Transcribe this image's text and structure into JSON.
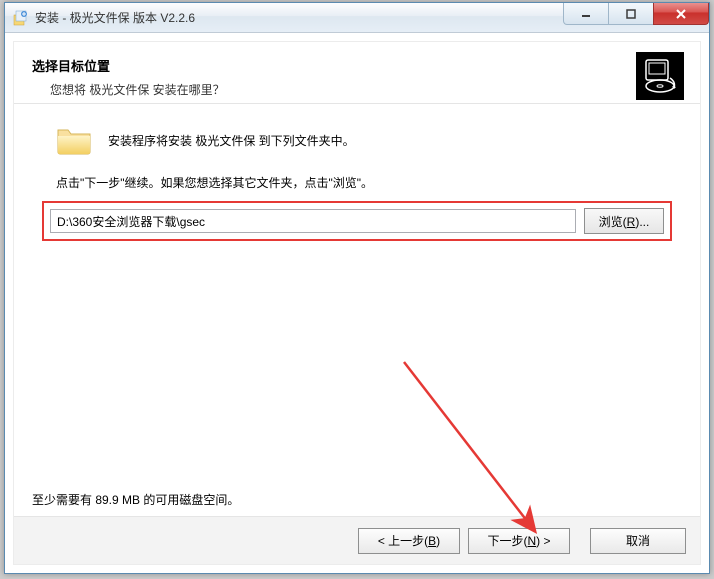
{
  "window": {
    "title": "安装 - 极光文件保 版本 V2.2.6"
  },
  "header": {
    "title": "选择目标位置",
    "subtitle": "您想将 极光文件保 安装在哪里？"
  },
  "main": {
    "folder_text": "安装程序将安装 极光文件保 到下列文件夹中。",
    "instruction": "点击\"下一步\"继续。如果您想选择其它文件夹，点击\"浏览\"。",
    "path_value": "D:\\360安全浏览器下载\\gsec",
    "browse_label": "浏览(R)...",
    "browse_key": "R",
    "disk_note": "至少需要有 89.9 MB 的可用磁盘空间。"
  },
  "footer": {
    "back_label": "< 上一步(B)",
    "back_key": "B",
    "next_label": "下一步(N) >",
    "next_key": "N",
    "cancel_label": "取消"
  }
}
